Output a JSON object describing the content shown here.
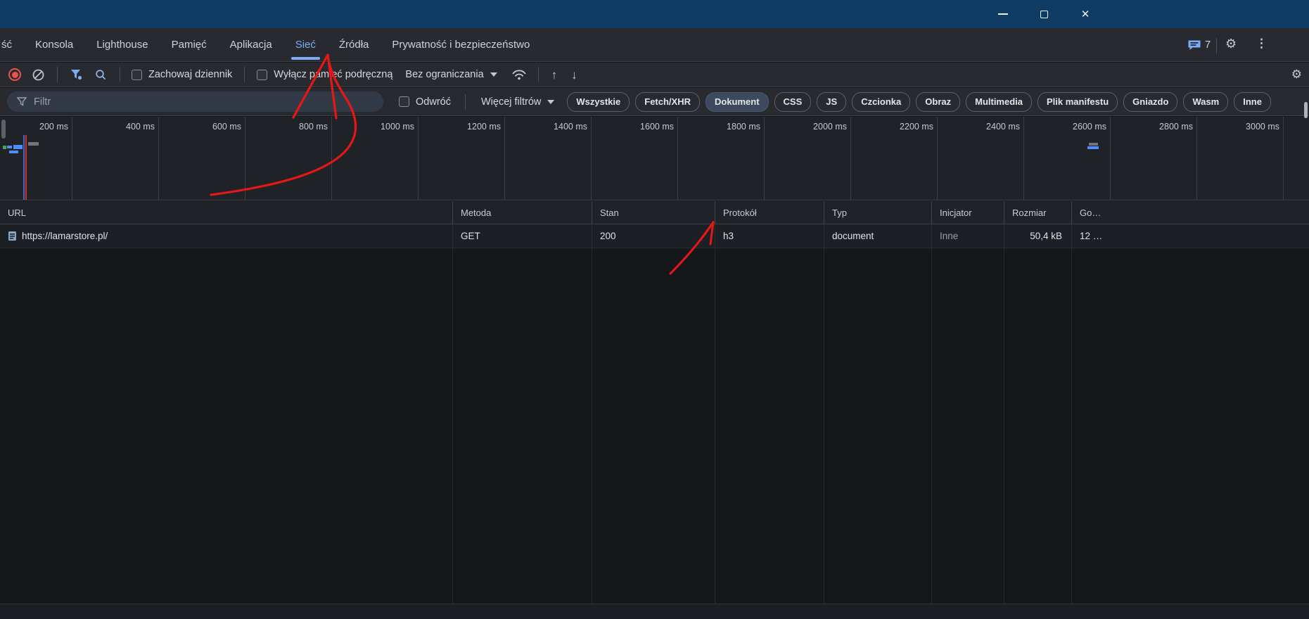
{
  "colors": {
    "titlebar_navy": "#0e3c64",
    "accent_blue": "#7cacf8",
    "record_red": "#e8544d",
    "annotation_red": "#e51717",
    "selected_chip_bg": "#3d495c"
  },
  "window_controls": {
    "close_glyph": "✕"
  },
  "devtools_tabs": {
    "items": [
      {
        "label": "ść",
        "selected": false
      },
      {
        "label": "Konsola",
        "selected": false
      },
      {
        "label": "Lighthouse",
        "selected": false
      },
      {
        "label": "Pamięć",
        "selected": false
      },
      {
        "label": "Aplikacja",
        "selected": false
      },
      {
        "label": "Sieć",
        "selected": true
      },
      {
        "label": "Źródła",
        "selected": false
      },
      {
        "label": "Prywatność i bezpieczeństwo",
        "selected": false
      }
    ],
    "issues_count": "7"
  },
  "network_toolbar": {
    "preserve_log_label": "Zachowaj dziennik",
    "disable_cache_label": "Wyłącz pamięć podręczną",
    "throttling_value": "Bez ograniczania"
  },
  "filter_bar": {
    "placeholder": "Filtr",
    "invert_label": "Odwróć",
    "more_filters_label": "Więcej filtrów",
    "chips": [
      {
        "label": "Wszystkie",
        "selected": false
      },
      {
        "label": "Fetch/XHR",
        "selected": false
      },
      {
        "label": "Dokument",
        "selected": true
      },
      {
        "label": "CSS",
        "selected": false
      },
      {
        "label": "JS",
        "selected": false
      },
      {
        "label": "Czcionka",
        "selected": false
      },
      {
        "label": "Obraz",
        "selected": false
      },
      {
        "label": "Multimedia",
        "selected": false
      },
      {
        "label": "Plik manifestu",
        "selected": false
      },
      {
        "label": "Gniazdo",
        "selected": false
      },
      {
        "label": "Wasm",
        "selected": false
      },
      {
        "label": "Inne",
        "selected": false
      }
    ]
  },
  "timeline": {
    "ticks": [
      "200 ms",
      "400 ms",
      "600 ms",
      "800 ms",
      "1000 ms",
      "1200 ms",
      "1400 ms",
      "1600 ms",
      "1800 ms",
      "2000 ms",
      "2200 ms",
      "2400 ms",
      "2600 ms",
      "2800 ms",
      "3000 ms"
    ]
  },
  "requests_table": {
    "columns": [
      "URL",
      "Metoda",
      "Stan",
      "Protokół",
      "Typ",
      "Inicjator",
      "Rozmiar",
      "Go…"
    ],
    "row": {
      "url": "https://lamarstore.pl/",
      "method": "GET",
      "status": "200",
      "protocol": "h3",
      "type": "document",
      "initiator": "Inne",
      "size": "50,4 kB",
      "time": "12 …"
    }
  }
}
